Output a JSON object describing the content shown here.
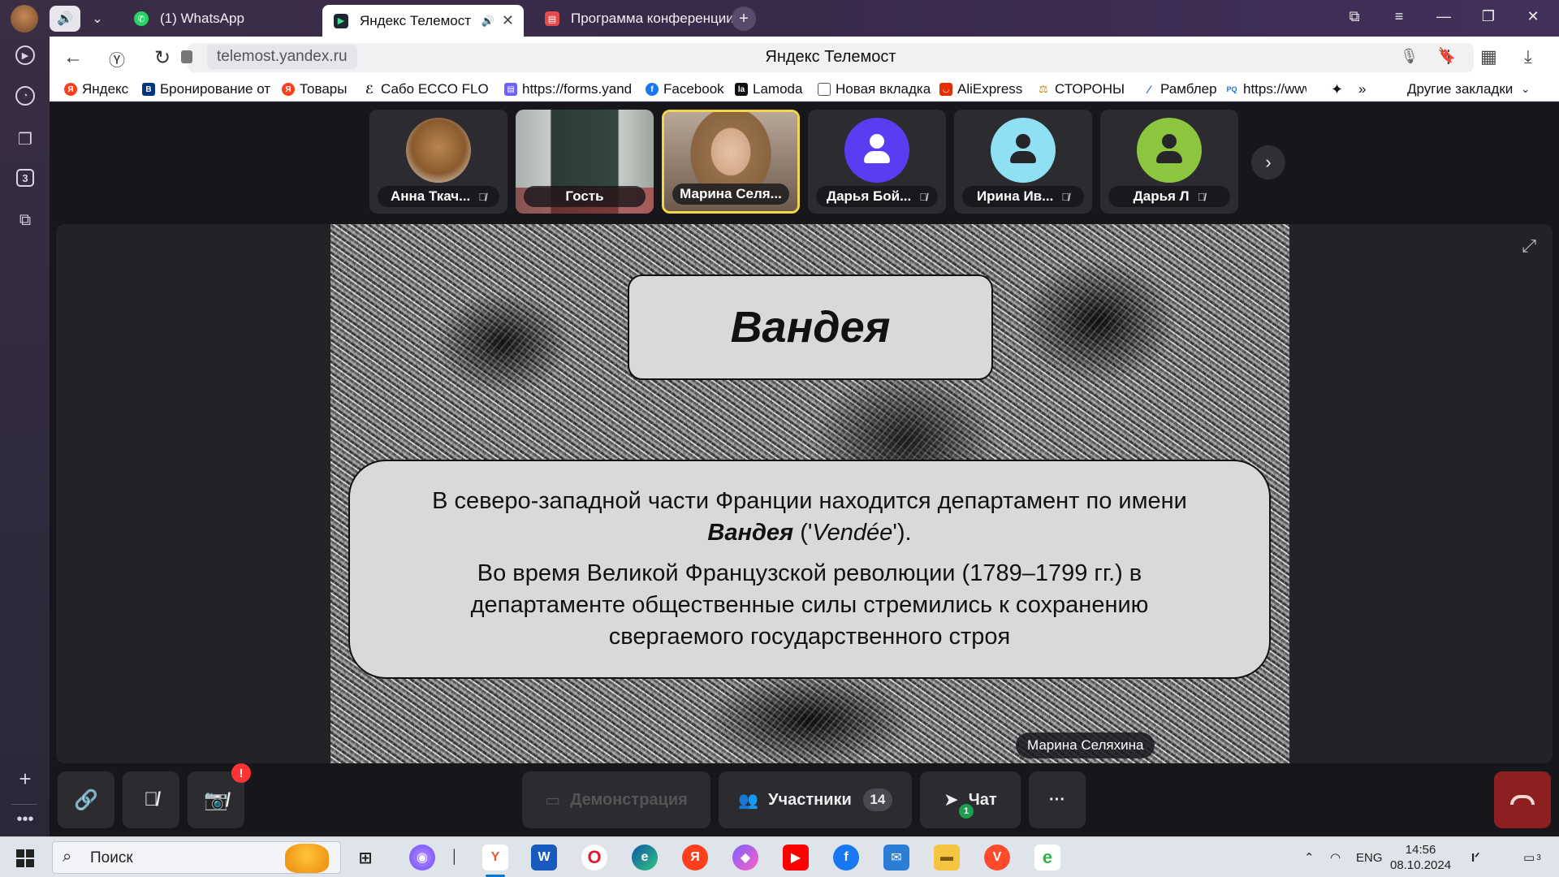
{
  "browser": {
    "tabs": [
      {
        "title": "(1) WhatsApp"
      },
      {
        "title": "Яндекс Телемост"
      },
      {
        "title": "Программа конференции"
      }
    ],
    "url": "telemost.yandex.ru",
    "page_title": "Яндекс Телемост",
    "rail_badge": "3",
    "bookmarks": [
      {
        "label": "Яндекс",
        "icon": "yandex-icon",
        "color": "#fc3f1d"
      },
      {
        "label": "Бронирование от",
        "icon": "booking-icon",
        "color": "#003580"
      },
      {
        "label": "Товары",
        "icon": "yandex-icon",
        "color": "#fc3f1d"
      },
      {
        "label": "Сабо ECCO FLOW",
        "icon": "ecco-icon",
        "color": "#111111"
      },
      {
        "label": "https://forms.yand",
        "icon": "forms-icon",
        "color": "#6c63ff"
      },
      {
        "label": "Facebook",
        "icon": "facebook-icon",
        "color": "#1877f2"
      },
      {
        "label": "Lamoda",
        "icon": "lamoda-icon",
        "color": "#111111"
      },
      {
        "label": "Новая вкладка",
        "icon": "page-icon",
        "color": "#ffffff"
      },
      {
        "label": "AliExpress",
        "icon": "aliexpress-icon",
        "color": "#e62e04"
      },
      {
        "label": "СТОРОНЫ",
        "icon": "scales-icon",
        "color": "#b8860b"
      },
      {
        "label": "Рамблер",
        "icon": "rambler-icon",
        "color": "#315efb"
      },
      {
        "label": "https://www",
        "icon": "pq-icon",
        "color": "#1a73e8"
      }
    ],
    "bookmarks_more": "»",
    "other_bookmarks": "Другие закладки"
  },
  "telemost": {
    "participants": [
      {
        "name": "Анна Ткач...",
        "avatar": "dog-photo",
        "muted": true
      },
      {
        "name": "Гость",
        "avatar": "classroom-camera",
        "muted": false
      },
      {
        "name": "Марина Селя...",
        "avatar": "webcam-woman",
        "muted": false,
        "speaking": true
      },
      {
        "name": "Дарья Бой...",
        "avatar": "person-icon",
        "color": "#5a3cf2",
        "muted": true
      },
      {
        "name": "Ирина Ив...",
        "avatar": "person-icon",
        "color": "#8fe0f2",
        "muted": true
      },
      {
        "name": "Дарья Л",
        "avatar": "person-icon",
        "color": "#8cc63f",
        "muted": true
      }
    ],
    "slide": {
      "title": "Вандея",
      "para1_a": "В северо-западной части Франции находится департамент по имени ",
      "para1_bold": "Вандея",
      "para1_b": " ('",
      "para1_italic": "Vendée",
      "para1_c": "').",
      "para2": "Во время Великой Французской революции (1789–1799 гг.) в департаменте общественные силы стремились к сохранению свергаемого государственного строя"
    },
    "presenter": "Марина Селяхина",
    "toolbar": {
      "demo_label": "Демонстрация",
      "participants_label": "Участники",
      "participants_count": "14",
      "chat_label": "Чат",
      "chat_unread": "1",
      "camera_alert": "!",
      "more": "···"
    }
  },
  "taskbar": {
    "search_placeholder": "Поиск",
    "lang": "ENG",
    "time": "14:56",
    "date": "08.10.2024",
    "notif_count": "3"
  }
}
